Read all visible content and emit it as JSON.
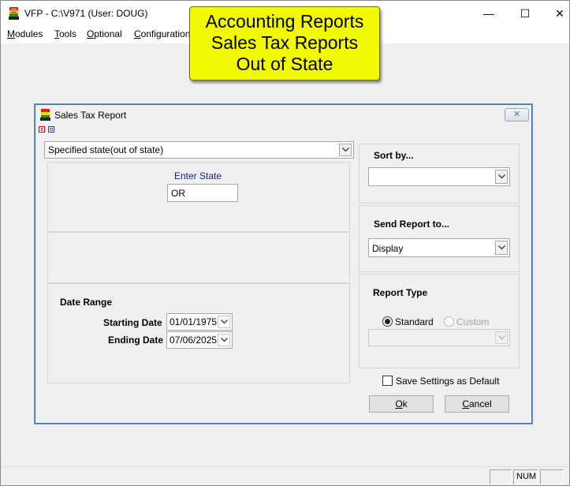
{
  "app": {
    "title": "VFP - C:\\V971  (User: DOUG)",
    "minimize_glyph": "—",
    "maximize_glyph": "☐",
    "close_glyph": "✕"
  },
  "menu": {
    "items": [
      {
        "underline": "M",
        "rest": "odules"
      },
      {
        "underline": "T",
        "rest": "ools"
      },
      {
        "underline": "O",
        "rest": "ptional"
      },
      {
        "underline": "C",
        "rest": "onfiguration"
      }
    ]
  },
  "callout": {
    "lines": [
      "Accounting Reports",
      "Sales Tax Reports",
      "Out of State"
    ]
  },
  "dialog": {
    "title": "Sales Tax Report",
    "close_glyph": "✕",
    "mini_buttons": [
      "x",
      "o"
    ],
    "report_scope": "Specified state(out of state)",
    "enter_state_label": "Enter State",
    "state_value": "OR",
    "date_range_label": "Date Range",
    "starting_date_label": "Starting Date",
    "starting_date": "01/01/1975",
    "ending_date_label": "Ending Date",
    "ending_date": "07/06/2025",
    "sort_by_label": "Sort by...",
    "sort_by_value": "",
    "send_report_label": "Send Report to...",
    "send_report_value": "Display",
    "report_type_label": "Report Type",
    "radio_standard": "Standard",
    "radio_custom": "Custom",
    "report_type_selected": "Standard",
    "custom_report_value": "",
    "save_default_label": "Save Settings as Default",
    "save_default_checked": false,
    "ok_underline": "O",
    "ok_rest": "k",
    "cancel_underline": "C",
    "cancel_rest": "ancel"
  },
  "statusbar": {
    "num_label": "NUM"
  },
  "colors": {
    "callout_bg": "#f2fa00",
    "enter_state_label": "#1a237e",
    "dialog_border": "#3c72b6"
  }
}
